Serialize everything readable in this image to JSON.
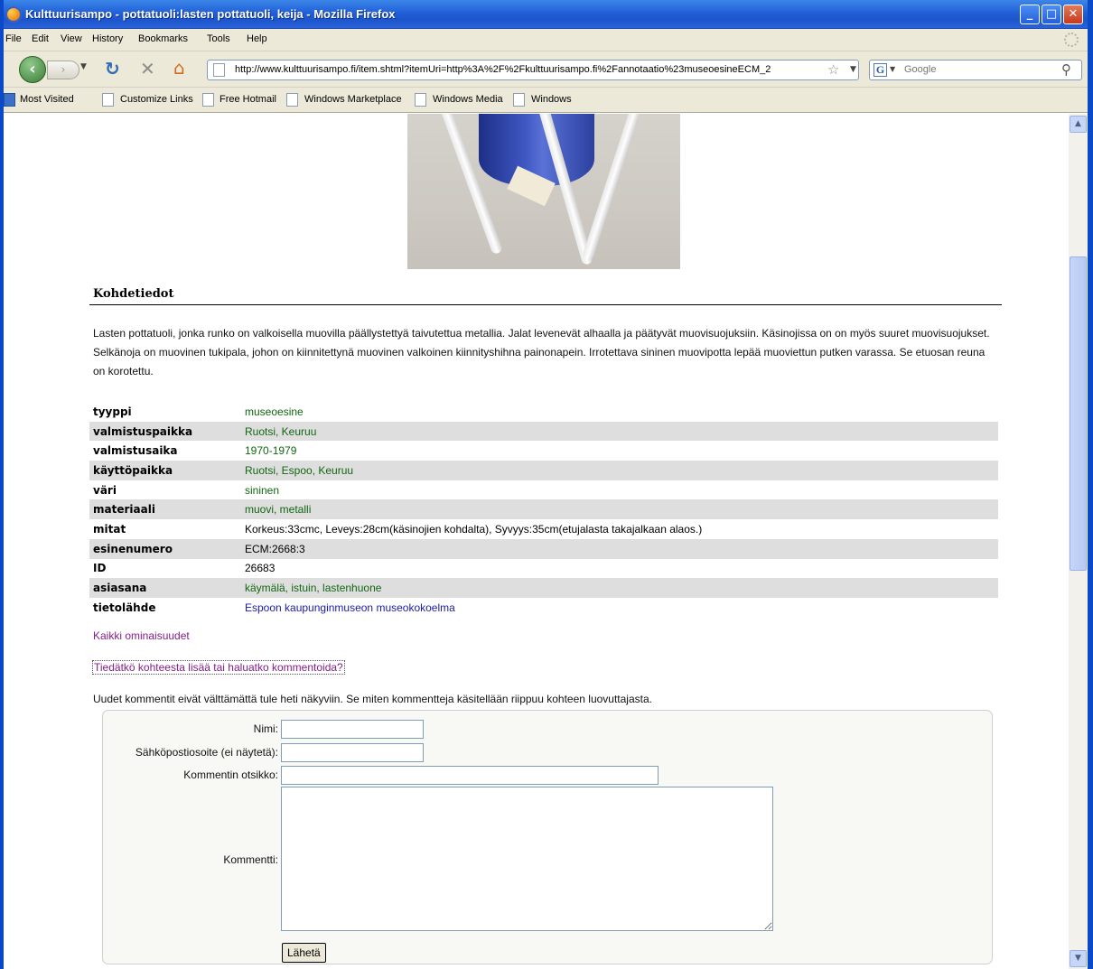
{
  "window": {
    "title": "Kulttuurisampo - pottatuoli:lasten pottatuoli, keija - Mozilla Firefox",
    "minimize": "_",
    "maximize": "□",
    "close": "✕"
  },
  "menu": [
    {
      "label": "File"
    },
    {
      "label": "Edit"
    },
    {
      "label": "View"
    },
    {
      "label": "History"
    },
    {
      "label": "Bookmarks"
    },
    {
      "label": "Tools"
    },
    {
      "label": "Help"
    }
  ],
  "nav": {
    "url": "http://www.kulttuurisampo.fi/item.shtml?itemUri=http%3A%2F%2Fkulttuurisampo.fi%2Fannotaatio%23museoesineECM_2",
    "search_placeholder": "Google",
    "search_engine_letter": "G"
  },
  "bookmarks": [
    {
      "label": "Most Visited",
      "icon": "rss-icon"
    },
    {
      "label": "Customize Links",
      "icon": "page-icon"
    },
    {
      "label": "Free Hotmail",
      "icon": "page-icon"
    },
    {
      "label": "Windows Marketplace",
      "icon": "page-icon"
    },
    {
      "label": "Windows Media",
      "icon": "page-icon"
    },
    {
      "label": "Windows",
      "icon": "page-icon"
    }
  ],
  "page": {
    "section_title": "Kohdetiedot",
    "description": "Lasten pottatuoli, jonka runko on valkoisella muovilla päällystettyä taivutettua metallia. Jalat levenevät alhaalla ja päätyvät muovisuojuksiin. Käsinojissa on on myös suuret muovisuojukset. Selkänoja on muovinen tukipala, johon on kiinnitettynä muovinen valkoinen kiinnityshihna painonapein. Irrotettava sininen muovipotta lepää muoviettun putken varassa. Se etuosan reuna on korotettu.",
    "properties": [
      {
        "key": "tyyppi",
        "value": "museoesine"
      },
      {
        "key": "valmistuspaikka",
        "value": "Ruotsi, Keuruu"
      },
      {
        "key": "valmistusaika",
        "value": "1970-1979"
      },
      {
        "key": "käyttöpaikka",
        "value": "Ruotsi, Espoo, Keuruu"
      },
      {
        "key": "väri",
        "value": "sininen"
      },
      {
        "key": "materiaali",
        "value": "muovi, metalli"
      },
      {
        "key": "mitat",
        "value": "Korkeus:33cmc, Leveys:28cm(käsinojien kohdalta), Syvyys:35cm(etujalasta takajalkaan alaos.)"
      },
      {
        "key": "esinenumero",
        "value": "ECM:2668:3"
      },
      {
        "key": "ID",
        "value": "26683"
      },
      {
        "key": "asiasana",
        "value": "käymälä, istuin, lastenhuone"
      },
      {
        "key": "tietolähde",
        "value": "Espoon kaupunginmuseon museokokoelma"
      }
    ],
    "all_properties_link": "Kaikki ominaisuudet",
    "comment_link": "Tiedätkö kohteesta lisää tai haluatko kommentoida?",
    "comment_note": "Uudet kommentit eivät välttämättä tule heti näkyviin. Se miten kommentteja käsitellään riippuu kohteen luovuttajasta.",
    "form": {
      "name_label": "Nimi:",
      "email_label": "Sähköpostiosoite (ei näytetä):",
      "subject_label": "Kommentin otsikko:",
      "comment_label": "Kommentti:",
      "submit_label": "Lähetä"
    }
  }
}
